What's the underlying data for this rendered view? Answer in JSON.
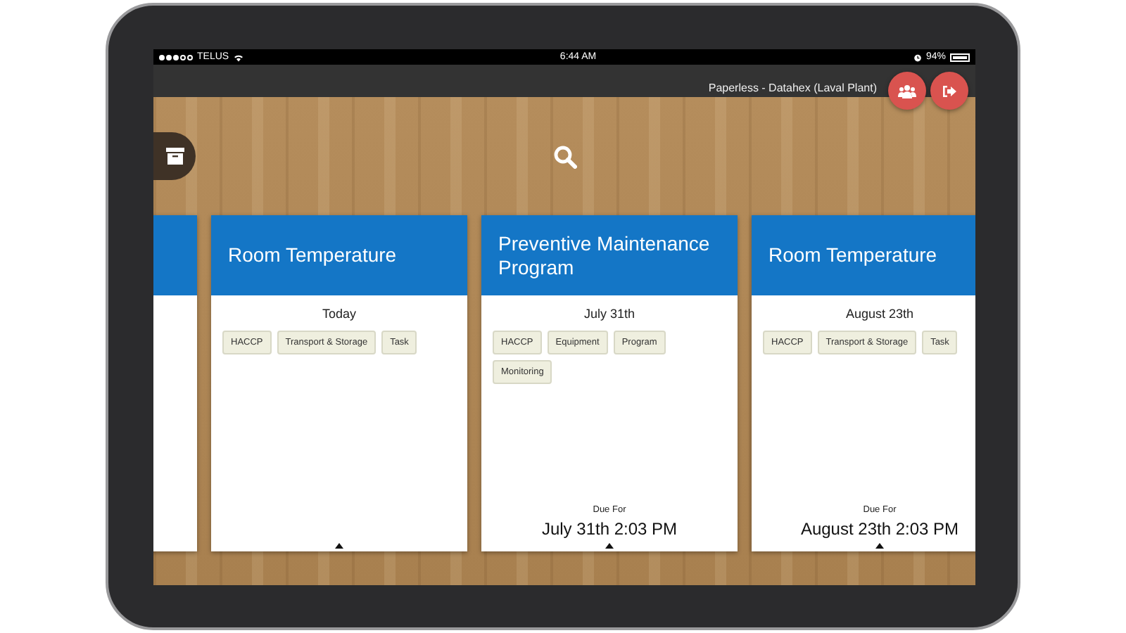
{
  "status_bar": {
    "carrier": "TELUS",
    "time": "6:44 AM",
    "battery": "94%"
  },
  "header": {
    "title": "Paperless - Datahex (Laval Plant)"
  },
  "cards": [
    {
      "title": "Room Temperature",
      "date": "Today",
      "tags": [
        "HACCP",
        "Transport & Storage",
        "Task"
      ]
    },
    {
      "title": "Preventive Maintenance Program",
      "date": "July 31th",
      "tags": [
        "HACCP",
        "Equipment",
        "Program",
        "Monitoring"
      ],
      "due_label": "Due For",
      "due": "July 31th 2:03 PM"
    },
    {
      "title": "Room Temperature",
      "date": "August 23th",
      "tags": [
        "HACCP",
        "Transport & Storage",
        "Task"
      ],
      "due_label": "Due For",
      "due": "August 23th 2:03 PM"
    }
  ]
}
